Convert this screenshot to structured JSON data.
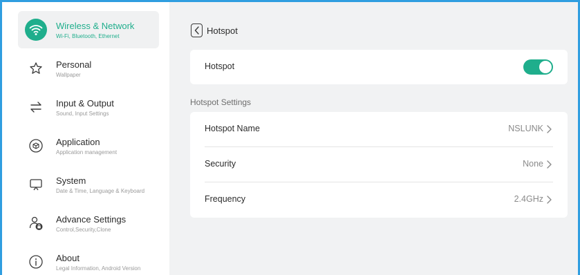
{
  "colors": {
    "accent": "#1fae8c",
    "frame": "#2f9ee0",
    "background": "#f1f2f3"
  },
  "sidebar": {
    "items": [
      {
        "icon": "wifi-icon",
        "title": "Wireless & Network",
        "subtitle": "Wi-Fi, Bluetooth, Ethernet",
        "active": true
      },
      {
        "icon": "star-icon",
        "title": "Personal",
        "subtitle": "Wallpaper",
        "active": false
      },
      {
        "icon": "swap-arrows-icon",
        "title": "Input & Output",
        "subtitle": "Sound, Input Settings",
        "active": false
      },
      {
        "icon": "cube-icon",
        "title": "Application",
        "subtitle": "Application management",
        "active": false
      },
      {
        "icon": "monitor-icon",
        "title": "System",
        "subtitle": "Date & Time, Language & Keyboard",
        "active": false
      },
      {
        "icon": "user-lock-icon",
        "title": "Advance Settings",
        "subtitle": "Control,Security,Clone",
        "active": false
      },
      {
        "icon": "info-icon",
        "title": "About",
        "subtitle": "Legal Information, Android Version",
        "active": false
      }
    ]
  },
  "main": {
    "title": "Hotspot",
    "hotspot_toggle": {
      "label": "Hotspot",
      "on": true
    },
    "section_label": "Hotspot Settings",
    "settings": [
      {
        "label": "Hotspot Name",
        "value": "NSLUNK"
      },
      {
        "label": "Security",
        "value": "None"
      },
      {
        "label": "Frequency",
        "value": "2.4GHz"
      }
    ]
  }
}
